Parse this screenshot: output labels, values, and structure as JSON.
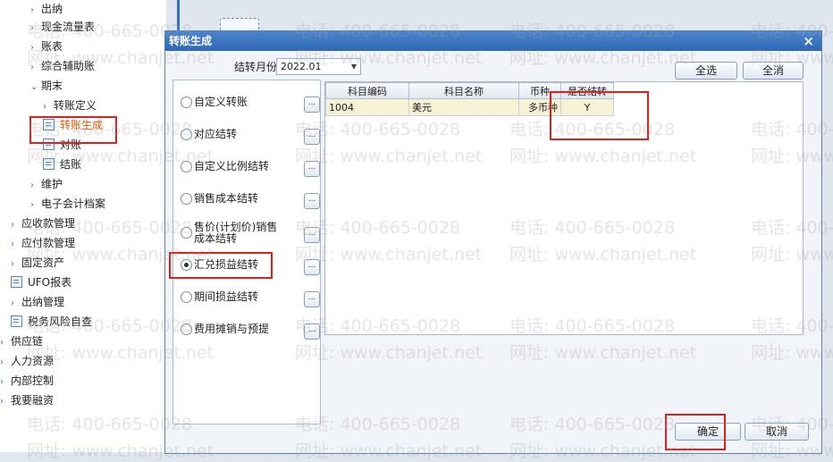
{
  "tree": {
    "items": [
      {
        "label": "出纳",
        "type": "arrow"
      },
      {
        "label": "现金流量表",
        "type": "arrow"
      },
      {
        "label": "账表",
        "type": "arrow"
      },
      {
        "label": "综合辅助账",
        "type": "arrow"
      },
      {
        "label": "期末",
        "type": "expanded"
      },
      {
        "label": "转账定义",
        "type": "arrow"
      },
      {
        "label": "转账生成",
        "type": "doc",
        "active": true
      },
      {
        "label": "对账",
        "type": "doc"
      },
      {
        "label": "结账",
        "type": "doc"
      },
      {
        "label": "维护",
        "type": "arrow"
      },
      {
        "label": "电子会计档案",
        "type": "arrow"
      },
      {
        "label": "应收款管理",
        "type": "arrow"
      },
      {
        "label": "应付款管理",
        "type": "arrow"
      },
      {
        "label": "固定资产",
        "type": "arrow"
      },
      {
        "label": "UFO报表",
        "type": "doc"
      },
      {
        "label": "出纳管理",
        "type": "arrow"
      },
      {
        "label": "税务风险自查",
        "type": "doc"
      },
      {
        "label": "供应链",
        "type": "arrow"
      },
      {
        "label": "人力资源",
        "type": "arrow"
      },
      {
        "label": "内部控制",
        "type": "arrow"
      },
      {
        "label": "我要融资",
        "type": "arrow"
      }
    ]
  },
  "dialog": {
    "title": "转账生成",
    "close_glyph": "×",
    "period_label": "结转月份",
    "period_value": "2022.01",
    "select_all": "全选",
    "deselect_all": "全消",
    "ok": "确定",
    "cancel": "取消",
    "options": [
      {
        "label": "自定义转账",
        "selected": false
      },
      {
        "label": "对应结转",
        "selected": false
      },
      {
        "label": "自定义比例结转",
        "selected": false
      },
      {
        "label": "销售成本结转",
        "selected": false
      },
      {
        "label": "售价(计划价)销售成本结转",
        "selected": false
      },
      {
        "label": "汇兑损益结转",
        "selected": true
      },
      {
        "label": "期间损益结转",
        "selected": false
      },
      {
        "label": "费用摊销与预提",
        "selected": false
      }
    ],
    "more_glyph": "...",
    "grid": {
      "columns": [
        "科目编码",
        "科目名称",
        "币种",
        "是否结转"
      ],
      "rows": [
        [
          "1004",
          "美元",
          "多币种",
          "Y"
        ]
      ]
    }
  },
  "watermark": {
    "phone": "电话: 400-665-0028",
    "site": "网址: www.chanjet.net"
  }
}
